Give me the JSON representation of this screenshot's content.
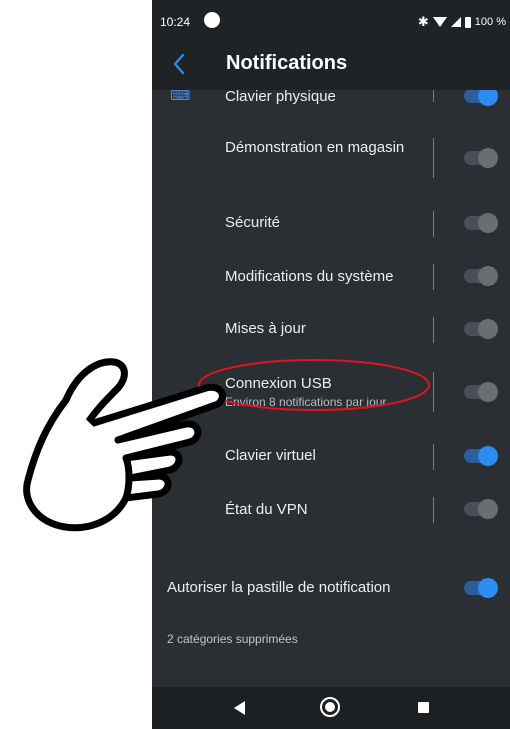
{
  "status_bar": {
    "time": "10:24",
    "battery": "100 %",
    "icons": [
      "bluetooth-icon",
      "wifi-icon",
      "signal-icon",
      "battery-icon"
    ]
  },
  "header": {
    "title": "Notifications",
    "back_icon": "chevron-left-icon",
    "accent": "#2d8cf0"
  },
  "categories": [
    {
      "label": "Clavier physique",
      "icon": "keyboard-icon",
      "enabled": true
    },
    {
      "label": "Démonstration en magasin",
      "enabled": false
    },
    {
      "label": "Sécurité",
      "enabled": false
    },
    {
      "label": "Modifications du système",
      "enabled": false
    },
    {
      "label": "Mises à jour",
      "enabled": false
    },
    {
      "label": "Connexion USB",
      "subtitle": "Environ 8 notifications par jour",
      "enabled": false,
      "highlighted": true
    },
    {
      "label": "Clavier virtuel",
      "enabled": true
    },
    {
      "label": "État du VPN",
      "enabled": false
    }
  ],
  "badge_setting": {
    "label": "Autoriser la pastille de notification",
    "enabled": true
  },
  "deleted_categories": "2 catégories supprimées",
  "nav_bar": {
    "icons": [
      "nav-back-icon",
      "nav-home-icon",
      "nav-recents-icon"
    ]
  },
  "overlay": {
    "icon": "pointing-hand-icon",
    "highlight_color": "#e0141c"
  }
}
